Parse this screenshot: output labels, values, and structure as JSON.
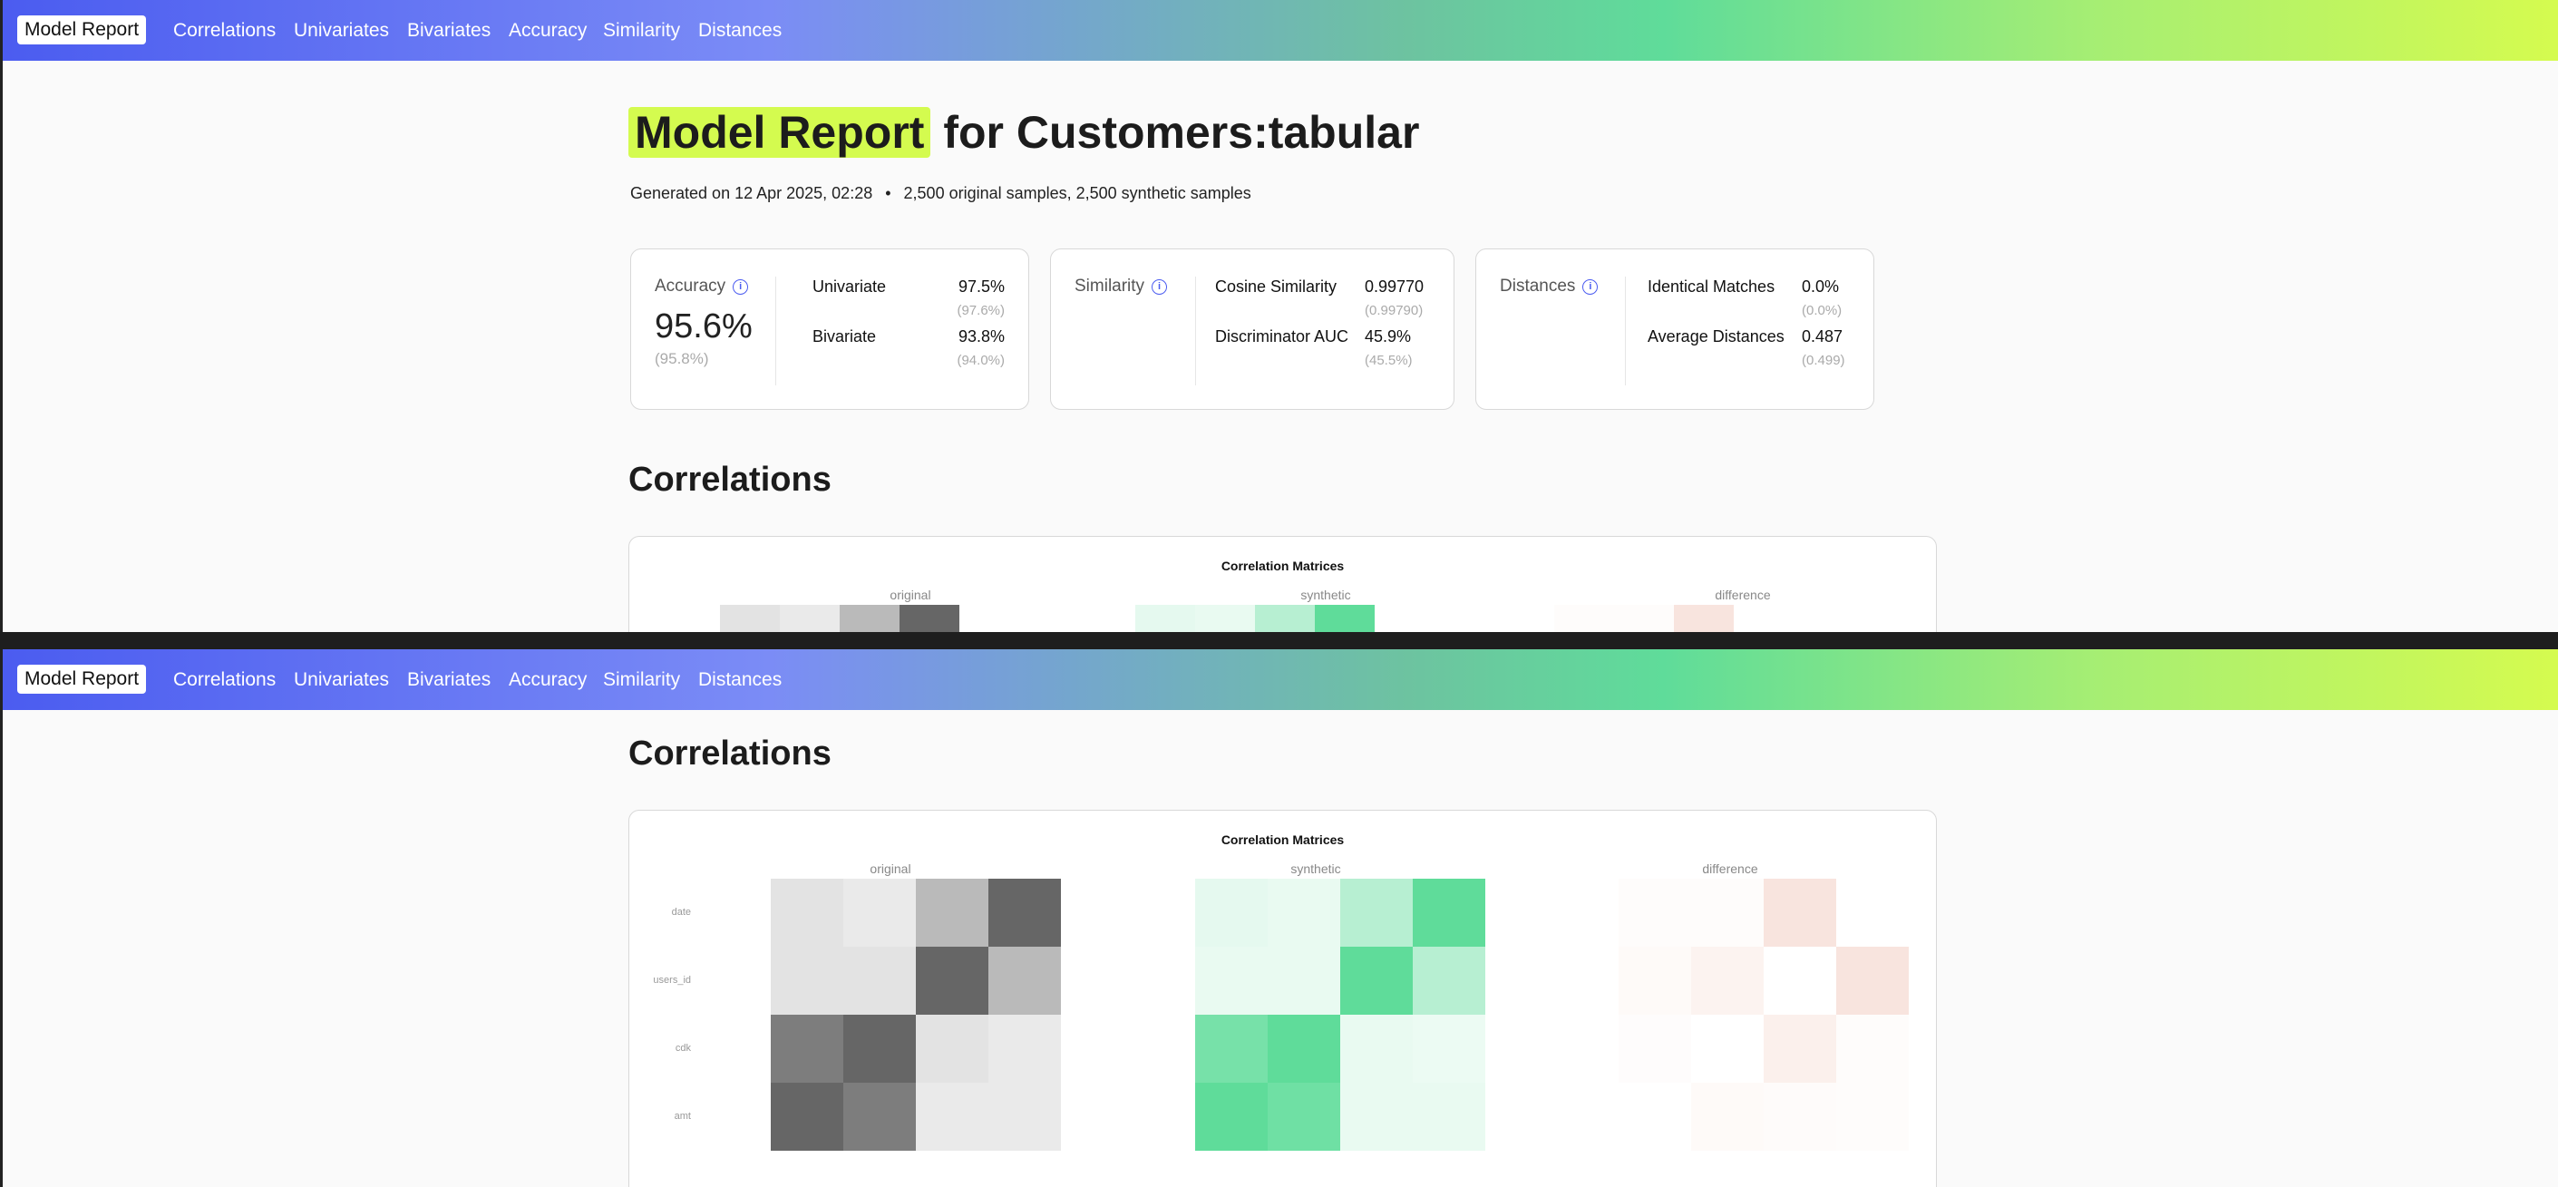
{
  "nav": {
    "brand": "Model Report",
    "links": [
      "Correlations",
      "Univariates",
      "Bivariates",
      "Accuracy",
      "Similarity",
      "Distances"
    ]
  },
  "header": {
    "title_highlight": "Model Report",
    "title_rest": "for Customers:tabular",
    "generated": "Generated on 12 Apr 2025, 02:28",
    "bullet": "•",
    "samples": "2,500 original samples, 2,500 synthetic samples"
  },
  "cards": {
    "accuracy": {
      "label": "Accuracy",
      "value": "95.6%",
      "sub": "(95.8%)",
      "metrics": [
        {
          "name": "Univariate",
          "value": "97.5%",
          "sub": "(97.6%)"
        },
        {
          "name": "Bivariate",
          "value": "93.8%",
          "sub": "(94.0%)"
        }
      ]
    },
    "similarity": {
      "label": "Similarity",
      "metrics": [
        {
          "name": "Cosine Similarity",
          "value": "0.99770",
          "sub": "(0.99790)"
        },
        {
          "name": "Discriminator AUC",
          "value": "45.9%",
          "sub": "(45.5%)"
        }
      ]
    },
    "distances": {
      "label": "Distances",
      "metrics": [
        {
          "name": "Identical Matches",
          "value": "0.0%",
          "sub": "(0.0%)"
        },
        {
          "name": "Average Distances",
          "value": "0.487",
          "sub": "(0.499)"
        }
      ]
    }
  },
  "correlations": {
    "heading": "Correlations",
    "chart_title": "Correlation Matrices",
    "panels": [
      "original",
      "synthetic",
      "difference"
    ],
    "row_labels": [
      "date",
      "users_id",
      "cdk",
      "amt"
    ]
  },
  "colors": {
    "accent": "#4b5cf0",
    "highlight": "#d4fb4f",
    "original_scale": "#666666",
    "synthetic_scale": "#5fdc9a",
    "difference_scale": "#f2cfc6"
  },
  "chart_data": {
    "type": "heatmap",
    "title": "Correlation Matrices",
    "variables": [
      "date",
      "users_id",
      "cdk",
      "amt"
    ],
    "panels": [
      {
        "name": "original",
        "intensity": [
          [
            0.18,
            0.14,
            0.45,
            1.0
          ],
          [
            0.18,
            0.18,
            1.0,
            0.45
          ],
          [
            0.85,
            1.0,
            0.18,
            0.14
          ],
          [
            1.0,
            0.85,
            0.14,
            0.14
          ]
        ]
      },
      {
        "name": "synthetic",
        "intensity": [
          [
            0.16,
            0.14,
            0.45,
            1.0
          ],
          [
            0.14,
            0.14,
            1.0,
            0.45
          ],
          [
            0.85,
            1.0,
            0.14,
            0.12
          ],
          [
            1.0,
            0.9,
            0.14,
            0.14
          ]
        ]
      },
      {
        "name": "difference",
        "intensity": [
          [
            0.06,
            0.06,
            0.5,
            0.0
          ],
          [
            0.1,
            0.22,
            0.0,
            0.5
          ],
          [
            0.05,
            0.0,
            0.28,
            0.06
          ],
          [
            0.0,
            0.1,
            0.08,
            0.06
          ]
        ]
      }
    ]
  }
}
